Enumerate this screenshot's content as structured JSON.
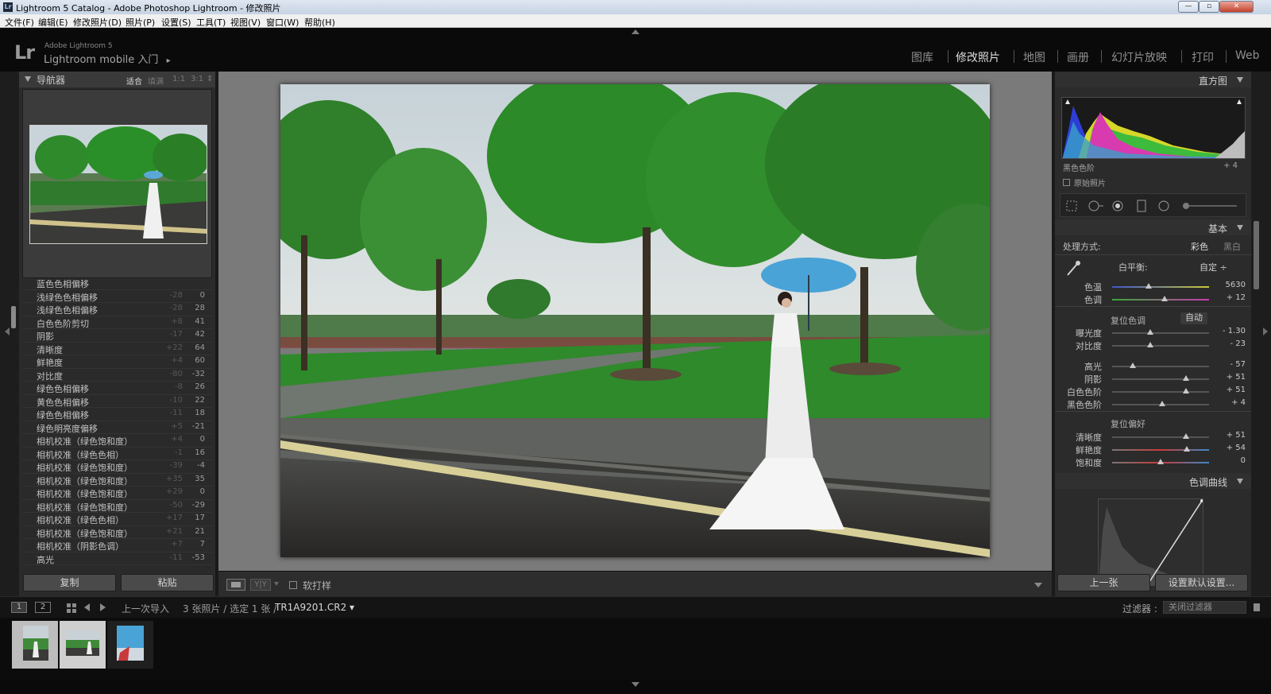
{
  "window": {
    "title": "Lightroom 5 Catalog - Adobe Photoshop Lightroom - 修改照片",
    "app_icon": "Lr"
  },
  "menu": [
    "文件(F)",
    "编辑(E)",
    "修改照片(D)",
    "照片(P)",
    "设置(S)",
    "工具(T)",
    "视图(V)",
    "窗口(W)",
    "帮助(H)"
  ],
  "identity": {
    "logo": "Lr",
    "small": "Adobe Lightroom 5",
    "big": "Lightroom mobile 入门",
    "arrow": "▸"
  },
  "modules": [
    {
      "label": "图库",
      "active": false
    },
    {
      "label": "修改照片",
      "active": true
    },
    {
      "label": "地图",
      "active": false
    },
    {
      "label": "画册",
      "active": false
    },
    {
      "label": "幻灯片放映",
      "active": false
    },
    {
      "label": "打印",
      "active": false
    },
    {
      "label": "Web",
      "active": false
    }
  ],
  "navigator": {
    "title": "导航器",
    "zoom": [
      {
        "label": "适合",
        "active": true
      },
      {
        "label": "填满",
        "active": false
      },
      {
        "label": "1:1",
        "active": false
      },
      {
        "label": "3:1",
        "active": false
      }
    ],
    "zoom_arrow": "⇕"
  },
  "history": [
    {
      "name": "蓝色色相偏移",
      "before": "",
      "after": ""
    },
    {
      "name": "浅绿色色相偏移",
      "before": "-28",
      "after": "0"
    },
    {
      "name": "浅绿色色相偏移",
      "before": "-28",
      "after": "28"
    },
    {
      "name": "白色色阶剪切",
      "before": "+8",
      "after": "41"
    },
    {
      "name": "阴影",
      "before": "-17",
      "after": "42"
    },
    {
      "name": "清晰度",
      "before": "+22",
      "after": "64"
    },
    {
      "name": "鲜艳度",
      "before": "+4",
      "after": "60"
    },
    {
      "name": "对比度",
      "before": "-80",
      "after": "-32"
    },
    {
      "name": "绿色色相偏移",
      "before": "-8",
      "after": "26"
    },
    {
      "name": "黄色色相偏移",
      "before": "-10",
      "after": "22"
    },
    {
      "name": "绿色色相偏移",
      "before": "-11",
      "after": "18"
    },
    {
      "name": "绿色明亮度偏移",
      "before": "+5",
      "after": "-21"
    },
    {
      "name": "相机校准（绿色饱和度）",
      "before": "+4",
      "after": "0"
    },
    {
      "name": "相机校准（绿色色相）",
      "before": "-1",
      "after": "16"
    },
    {
      "name": "相机校准（绿色饱和度）",
      "before": "-39",
      "after": "-4"
    },
    {
      "name": "相机校准（绿色饱和度）",
      "before": "+35",
      "after": "35"
    },
    {
      "name": "相机校准（绿色饱和度）",
      "before": "+29",
      "after": "0"
    },
    {
      "name": "相机校准（绿色饱和度）",
      "before": "-50",
      "after": "-29"
    },
    {
      "name": "相机校准（绿色色相）",
      "before": "+17",
      "after": "17"
    },
    {
      "name": "相机校准（绿色饱和度）",
      "before": "+21",
      "after": "21"
    },
    {
      "name": "相机校准（阴影色调）",
      "before": "+7",
      "after": "7"
    },
    {
      "name": "高光",
      "before": "-11",
      "after": "-53"
    }
  ],
  "left_buttons": {
    "copy": "复制",
    "paste": "粘贴"
  },
  "toolbar": {
    "yy": "Y|Y",
    "softproof": "软打样"
  },
  "histogram": {
    "title": "直方图",
    "info_label": "黑色色阶",
    "info_value": "+ 4",
    "original_label": "原始照片"
  },
  "basic": {
    "title": "基本",
    "treatment_label": "处理方式:",
    "treatment_color": "彩色",
    "treatment_bw": "黑白",
    "wb_label": "白平衡:",
    "wb_value": "自定 ÷",
    "tone_label": "复位色调",
    "auto_label": "自动",
    "presence_label": "复位偏好",
    "sliders": [
      {
        "label": "色温",
        "value": "5630",
        "pos": 0.38,
        "track": "temp"
      },
      {
        "label": "色调",
        "value": "+ 12",
        "pos": 0.54,
        "track": "tint"
      },
      {
        "label": "曝光度",
        "value": "- 1.30",
        "pos": 0.39,
        "track": "plain"
      },
      {
        "label": "对比度",
        "value": "- 23",
        "pos": 0.39,
        "track": "plain"
      },
      {
        "label": "高光",
        "value": "- 57",
        "pos": 0.21,
        "track": "plain"
      },
      {
        "label": "阴影",
        "value": "+ 51",
        "pos": 0.76,
        "track": "plain"
      },
      {
        "label": "白色色阶",
        "value": "+ 51",
        "pos": 0.76,
        "track": "plain"
      },
      {
        "label": "黑色色阶",
        "value": "+ 4",
        "pos": 0.52,
        "track": "plain"
      },
      {
        "label": "清晰度",
        "value": "+ 51",
        "pos": 0.76,
        "track": "plain"
      },
      {
        "label": "鲜艳度",
        "value": "+ 54",
        "pos": 0.77,
        "track": "vib"
      },
      {
        "label": "饱和度",
        "value": "0",
        "pos": 0.5,
        "track": "sat"
      }
    ]
  },
  "tone_curve": {
    "title": "色调曲线"
  },
  "right_buttons": {
    "prev": "上一张",
    "reset": "设置默认设置..."
  },
  "filmstrip": {
    "screen1": "1",
    "screen2": "2",
    "source": "上一次导入",
    "count": "3 张照片 / 选定 1 张 /",
    "file": "TR1A9201.CR2 ▾",
    "filter_label": "过滤器 :",
    "filter_value": "关闭过滤器"
  },
  "colors": {
    "accent": "#dcdcdc",
    "panel": "#2b2b2b",
    "background": "#7a7a7a"
  }
}
